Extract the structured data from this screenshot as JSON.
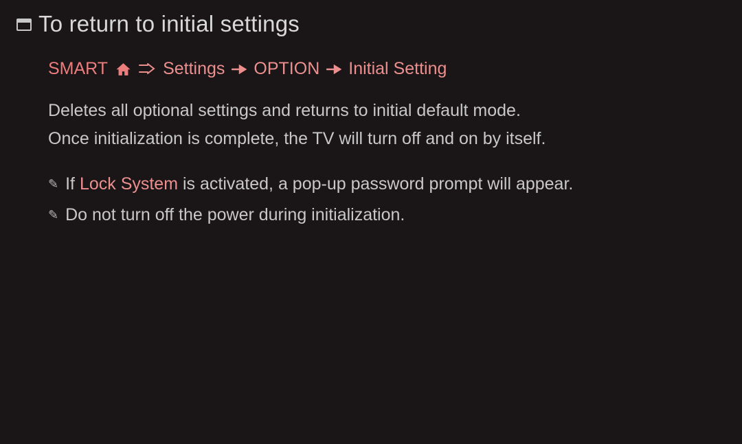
{
  "title": "To return to initial settings",
  "breadcrumb": {
    "smart": "SMART",
    "settings": "Settings",
    "option": "OPTION",
    "initialSetting": "Initial Setting"
  },
  "description": {
    "line1": "Deletes all optional settings and returns to initial default mode.",
    "line2": "Once initialization is complete, the TV will turn off and on by itself."
  },
  "notes": {
    "note1_prefix": "If ",
    "note1_highlight": "Lock System",
    "note1_suffix": " is activated, a pop-up password prompt will appear.",
    "note2": "Do not turn off the power during initialization."
  }
}
